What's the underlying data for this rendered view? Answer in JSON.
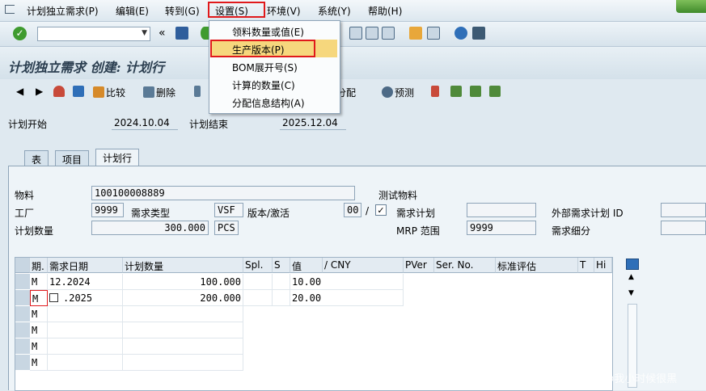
{
  "menubar": {
    "items": [
      "计划独立需求(P)",
      "编辑(E)",
      "转到(G)",
      "设置(S)",
      "环境(V)",
      "系统(Y)",
      "帮助(H)"
    ]
  },
  "settings_menu": {
    "items": [
      "领料数量或值(E)",
      "生产版本(P)",
      "BOM展开号(S)",
      "计算的数量(C)",
      "分配信息结构(A)"
    ],
    "highlighted": "生产版本(P)"
  },
  "toolbar": {
    "back_chevron": "«"
  },
  "page_title": "计划独立需求 创建: 计划行",
  "app_toolbar": {
    "compare": "比较",
    "delete": "删除",
    "allocate": "分配",
    "forecast": "预测"
  },
  "header": {
    "plan_start_label": "计划开始",
    "plan_start_value": "2024.10.04",
    "plan_end_label": "计划结束",
    "plan_end_value": "2025.12.04"
  },
  "tabs": [
    "表",
    "项目",
    "计划行"
  ],
  "active_tab": "计划行",
  "form": {
    "material_label": "物料",
    "material_value": "100100008889",
    "material_desc": "测试物料",
    "plant_label": "工厂",
    "plant_value": "9999",
    "req_type_label": "需求类型",
    "req_type_value": "VSF",
    "version_label": "版本/激活",
    "version_value": "00",
    "version_slash": "/",
    "active_check": "✓",
    "req_plan_label": "需求计划",
    "req_plan_value": "",
    "ext_req_plan_label": "外部需求计划 ID",
    "ext_req_plan_value": "",
    "plan_qty_label": "计划数量",
    "plan_qty_value": "300.000",
    "uom_value": "PCS",
    "mrp_area_label": "MRP 范围",
    "mrp_area_value": "9999",
    "req_detail_label": "需求细分",
    "req_detail_value": ""
  },
  "table": {
    "columns": [
      "期.",
      "需求日期",
      "计划数量",
      "Spl.",
      "S",
      "值",
      "/ CNY",
      "PVer",
      "Ser. No.",
      "标准评估",
      "T",
      "Hi"
    ],
    "rows": [
      {
        "period": "M",
        "date": "12.2024",
        "qty": "100.000",
        "value": "10.00"
      },
      {
        "period": "M",
        "date": ".2025",
        "qty": "200.000",
        "value": "20.00"
      },
      {
        "period": "M",
        "date": "",
        "qty": "",
        "value": ""
      },
      {
        "period": "M",
        "date": "",
        "qty": "",
        "value": ""
      },
      {
        "period": "M",
        "date": "",
        "qty": "",
        "value": ""
      },
      {
        "period": "M",
        "date": "",
        "qty": "",
        "value": ""
      }
    ]
  },
  "scroll": {
    "up": "▲",
    "down": "▼"
  },
  "watermark": "CSDN @我小时候很黑"
}
